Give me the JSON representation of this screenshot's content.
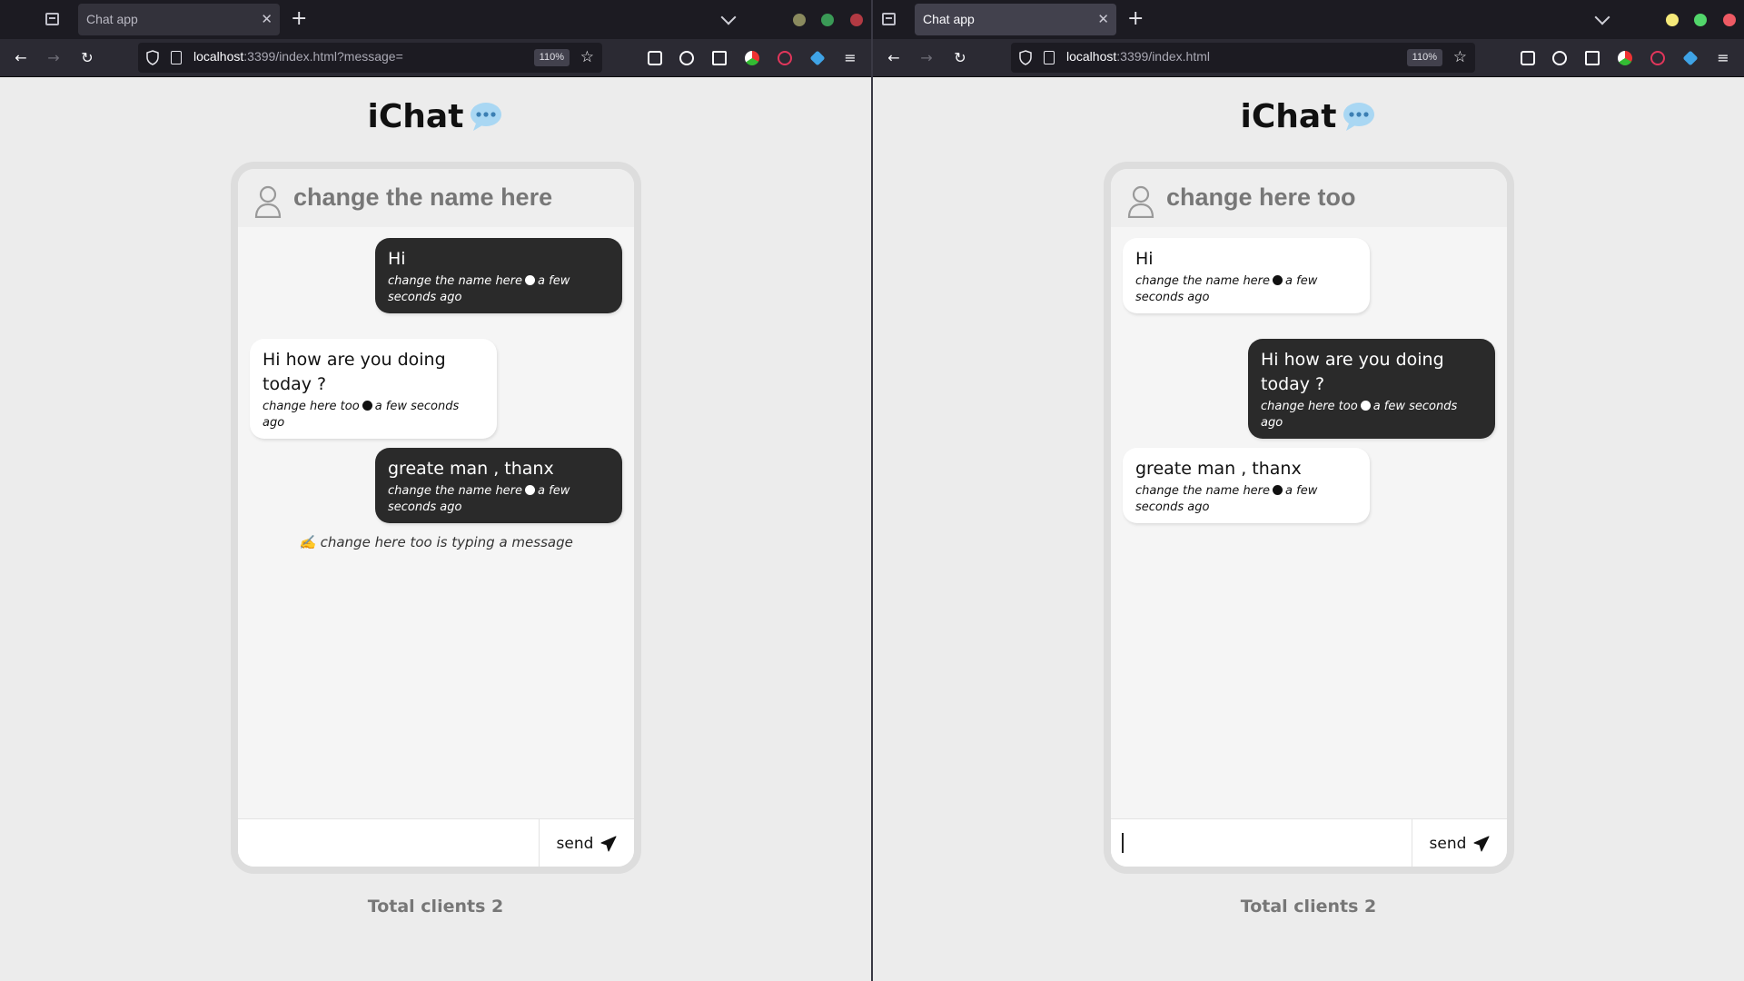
{
  "windows": [
    {
      "tab_title": "Chat app",
      "url_host": "localhost",
      "url_rest": ":3399/index.html?message=",
      "zoom": "110%",
      "app_title": "iChat",
      "chat_name": "change the name here",
      "messages": [
        {
          "text": "Hi",
          "author": "change the name here",
          "time": "a few seconds ago",
          "style": "dark"
        },
        {
          "text": "Hi how are you doing today ?",
          "author": "change here too",
          "time": "a few seconds ago",
          "style": "light"
        },
        {
          "text": "greate man , thanx",
          "author": "change the name here",
          "time": "a few seconds ago",
          "style": "dark"
        }
      ],
      "typing": "✍️ change here too is typing a message",
      "input_value": "",
      "send_label": "send",
      "clients_label": "Total clients 2"
    },
    {
      "tab_title": "Chat app",
      "url_host": "localhost",
      "url_rest": ":3399/index.html",
      "zoom": "110%",
      "app_title": "iChat",
      "chat_name": "change here too",
      "messages": [
        {
          "text": "Hi",
          "author": "change the name here",
          "time": "a few seconds ago",
          "style": "light"
        },
        {
          "text": "Hi how are you doing today ?",
          "author": "change here too",
          "time": "a few seconds ago",
          "style": "dark"
        },
        {
          "text": "greate man , thanx",
          "author": "change the name here",
          "time": "a few seconds ago",
          "style": "light"
        }
      ],
      "typing": "",
      "input_value": "",
      "send_label": "send",
      "clients_label": "Total clients 2"
    }
  ],
  "icons": {
    "tab_list": "tab-list-icon",
    "new_tab": "plus-icon",
    "back": "back-arrow-icon",
    "forward": "forward-arrow-icon",
    "reload": "reload-icon",
    "shield": "tracking-shield-icon",
    "bookmark": "star-icon",
    "app_logo": "chat-bubble-icon",
    "avatar": "user-icon",
    "send": "paper-plane-icon"
  },
  "colors": {
    "chrome_dark": "#1c1b22",
    "toolbar": "#2b2a33",
    "page_bg": "#ececec",
    "dark_bubble": "#2a2a2a",
    "light_bubble": "#ffffff",
    "accent_bubble": "#9fd0ef"
  }
}
